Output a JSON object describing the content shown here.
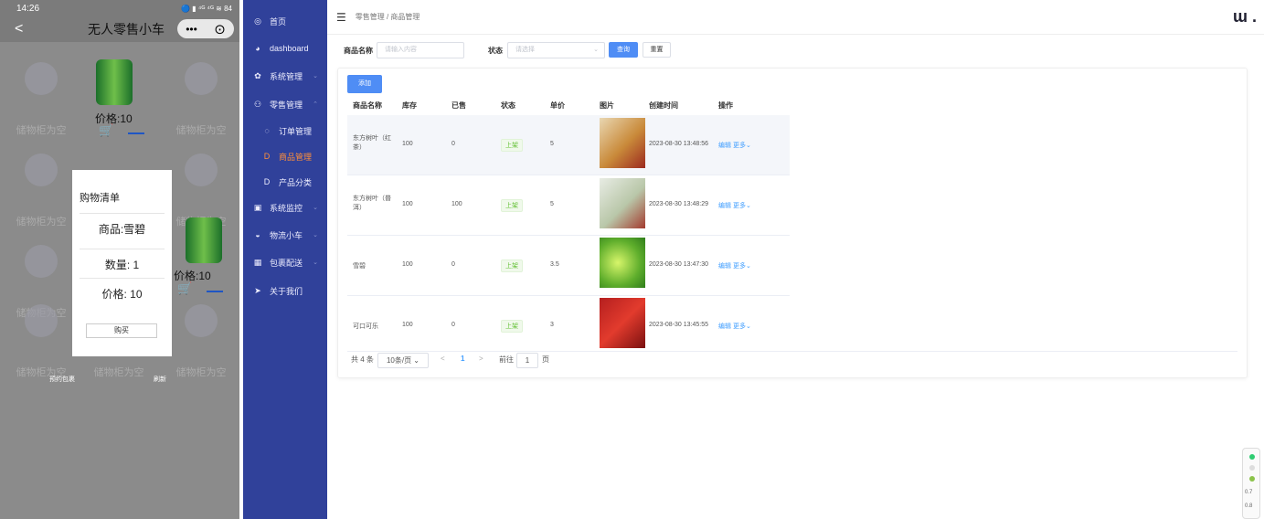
{
  "phone": {
    "time": "14:26",
    "status_icons": "🔵 ▮ ⁴ᴳ ⁴ᴳ ≋ 84",
    "back": "<",
    "title": "无人零售小车",
    "capsule_more": "•••",
    "capsule_close": "⊙",
    "empty_label": "储物柜为空",
    "price1": "价格:10",
    "price2": "价格:10",
    "cart_icon": "🛒",
    "modal": {
      "title": "购物清单",
      "product": "商品:雪碧",
      "quantity": "数量:  1",
      "price": "价格:  10",
      "buy": "购买"
    },
    "bottom_left": "预约包裹",
    "bottom_right": "刷新"
  },
  "sidebar": {
    "items": [
      {
        "icon": "◎",
        "label": "首页"
      },
      {
        "icon": "◕",
        "label": "dashboard"
      },
      {
        "icon": "✿",
        "label": "系统管理",
        "arrow": "⌄"
      },
      {
        "icon": "⚇",
        "label": "零售管理",
        "arrow": "⌃"
      },
      {
        "icon": "◌",
        "label": "订单管理"
      },
      {
        "icon": "D",
        "label": "商品管理"
      },
      {
        "icon": "D",
        "label": "产品分类"
      },
      {
        "icon": "▣",
        "label": "系统监控",
        "arrow": "⌄"
      },
      {
        "icon": "◒",
        "label": "物流小车",
        "arrow": "⌄"
      },
      {
        "icon": "▦",
        "label": "包裹配送",
        "arrow": "⌄"
      },
      {
        "icon": "➤",
        "label": "关于我们"
      }
    ]
  },
  "header": {
    "toggle": "☰",
    "breadcrumb": "零售管理  /  商品管理",
    "logo": "ɯ ."
  },
  "filter": {
    "name_label": "商品名称",
    "name_placeholder": "请输入内容",
    "status_label": "状态",
    "status_placeholder": "请选择",
    "search": "查询",
    "reset": "重置"
  },
  "table": {
    "add": "添加",
    "headers": [
      "商品名称",
      "库存",
      "已售",
      "状态",
      "单价",
      "图片",
      "创建时间",
      "操作"
    ],
    "rows": [
      {
        "name": "东方树叶（红\n茶）",
        "stock": "100",
        "sold": "0",
        "status": "上架",
        "price": "5",
        "time": "2023-08-30 13:48:56",
        "edit": "编辑",
        "more": "更多⌄"
      },
      {
        "name": "东方树叶（普\n洱）",
        "stock": "100",
        "sold": "100",
        "status": "上架",
        "price": "5",
        "time": "2023-08-30 13:48:29",
        "edit": "编辑",
        "more": "更多⌄"
      },
      {
        "name": "雪碧",
        "stock": "100",
        "sold": "0",
        "status": "上架",
        "price": "3.5",
        "time": "2023-08-30 13:47:30",
        "edit": "编辑",
        "more": "更多⌄"
      },
      {
        "name": "可口可乐",
        "stock": "100",
        "sold": "0",
        "status": "上架",
        "price": "3",
        "time": "2023-08-30 13:45:55",
        "edit": "编辑",
        "more": "更多⌄"
      }
    ]
  },
  "pagination": {
    "total": "共 4 条",
    "size": "10条/页  ⌄",
    "prev": "<",
    "page": "1",
    "next": ">",
    "goto": "前往",
    "goto_value": "1",
    "page_unit": "页"
  },
  "corner": {
    "a": "0.7",
    "b": "0.8"
  }
}
